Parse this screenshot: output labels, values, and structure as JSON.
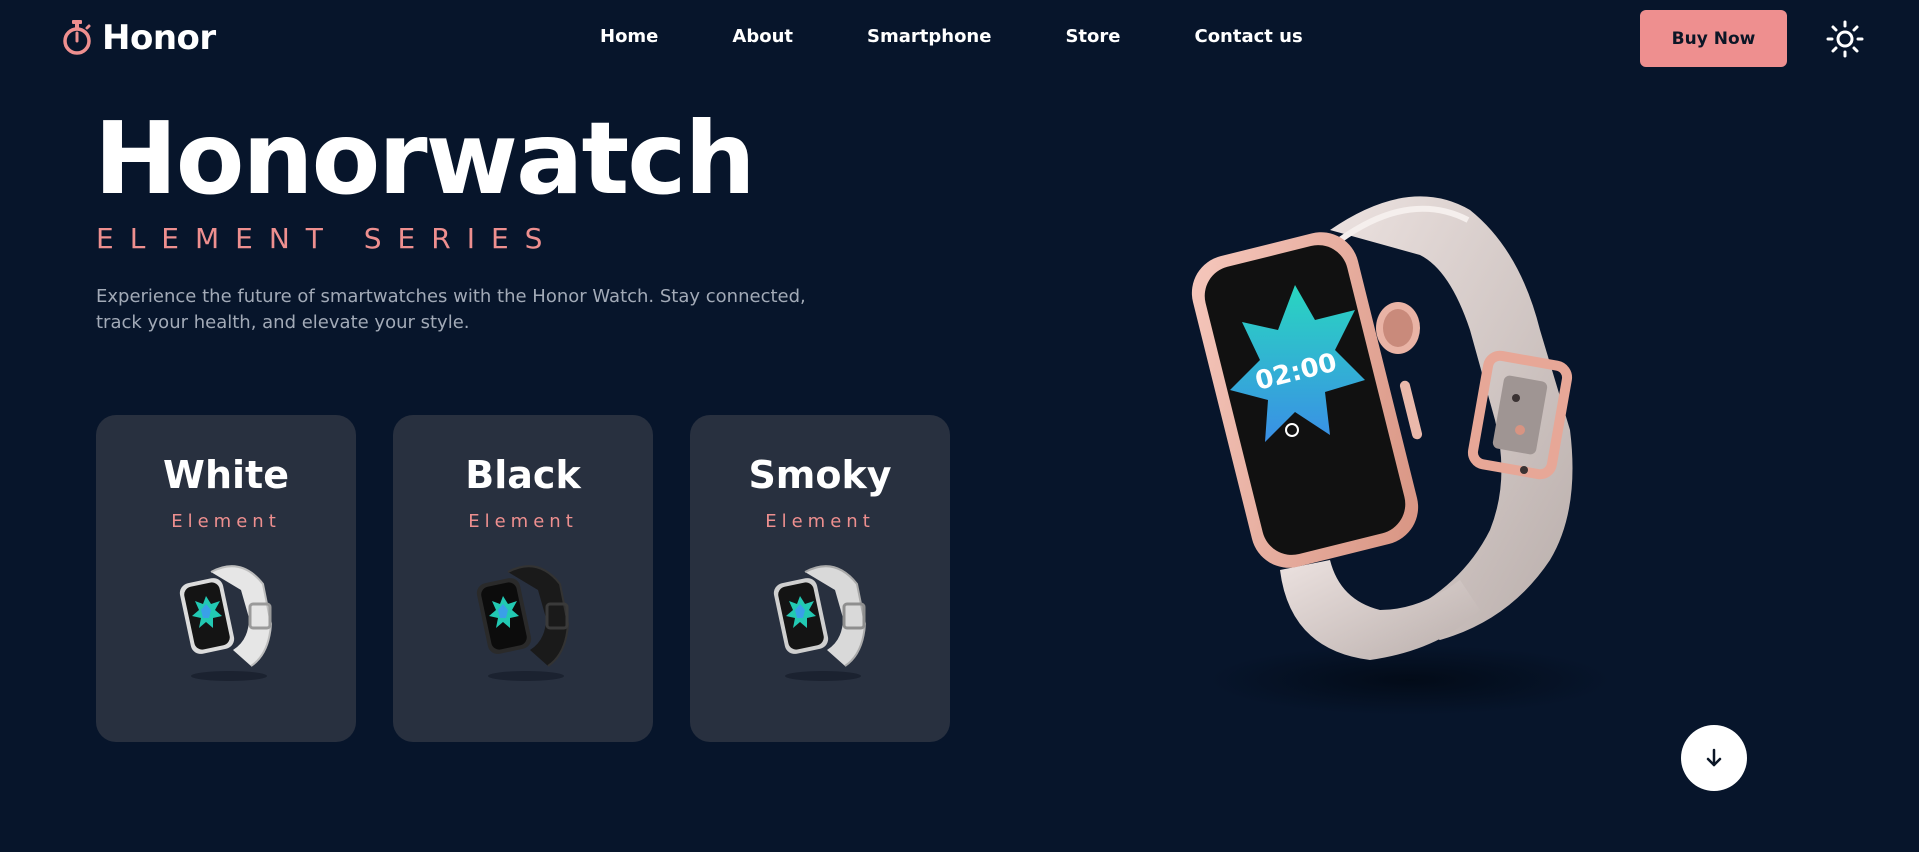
{
  "brand": {
    "name": "Honor",
    "icon": "stopwatch-icon"
  },
  "nav": {
    "items": [
      {
        "label": "Home"
      },
      {
        "label": "About"
      },
      {
        "label": "Smartphone"
      },
      {
        "label": "Store"
      },
      {
        "label": "Contact us"
      }
    ]
  },
  "header": {
    "buy_label": "Buy Now",
    "theme_icon": "sun-icon"
  },
  "hero": {
    "title": "Honorwatch",
    "subtitle": "ELEMENT SERIES",
    "description_line1": "Experience the future of smartwatches with the Honor Watch. Stay connected,",
    "description_line2": "track your health, and elevate your style."
  },
  "cards": [
    {
      "title": "White",
      "subtitle": "Element"
    },
    {
      "title": "Black",
      "subtitle": "Element"
    },
    {
      "title": "Smoky",
      "subtitle": "Element"
    }
  ],
  "watch_screen": {
    "time": "02:00"
  },
  "scroll": {
    "icon": "arrow-down-icon"
  },
  "colors": {
    "background": "#07152b",
    "accent": "#ee8f8f",
    "card": "#28303f",
    "text_muted": "#a2aab7"
  }
}
